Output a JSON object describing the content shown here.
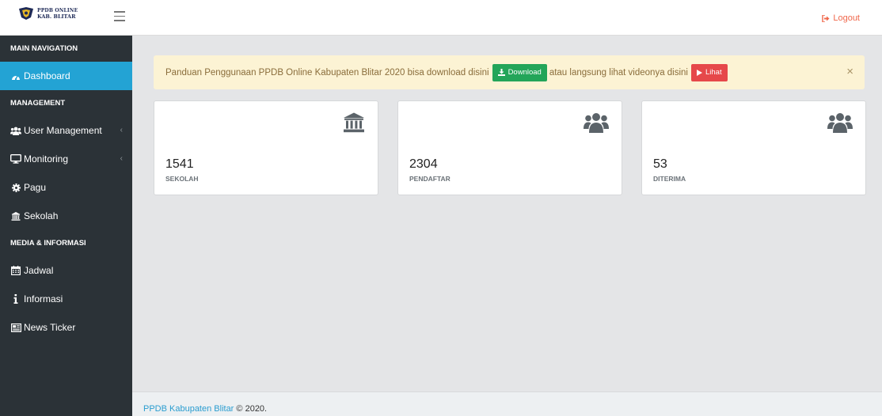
{
  "header": {
    "logo_line1": "PPDB ONLINE",
    "logo_line2": "KAB. BLITAR",
    "logout_label": "Logout"
  },
  "sidebar": {
    "section_main": "MAIN NAVIGATION",
    "dashboard": "Dashboard",
    "section_management": "MANAGEMENT",
    "user_management": "User Management",
    "monitoring": "Monitoring",
    "pagu": "Pagu",
    "sekolah": "Sekolah",
    "section_media": "MEDIA & INFORMASI",
    "jadwal": "Jadwal",
    "informasi": "Informasi",
    "news_ticker": "News Ticker",
    "chevron": "‹"
  },
  "alert": {
    "text_before": "Panduan Penggunaan PPDB Online Kabupaten Blitar 2020 bisa download disini",
    "download_label": "Download",
    "text_middle": "atau langsung lihat videonya disini",
    "lihat_label": "Lihat",
    "close_symbol": "×"
  },
  "stats": [
    {
      "value": "1541",
      "label": "SEKOLAH",
      "icon": "institution-icon"
    },
    {
      "value": "2304",
      "label": "PENDAFTAR",
      "icon": "users-icon"
    },
    {
      "value": "53",
      "label": "DITERIMA",
      "icon": "users-icon"
    }
  ],
  "footer": {
    "link": "PPDB Kabupaten Blitar",
    "suffix": "© 2020."
  },
  "colors": {
    "sidebar_bg": "#2b3237",
    "active": "#23a3d4",
    "download_btn": "#23a559",
    "lihat_btn": "#e6484a",
    "logout": "#f0684c",
    "alert_bg": "#fcf3d4"
  }
}
